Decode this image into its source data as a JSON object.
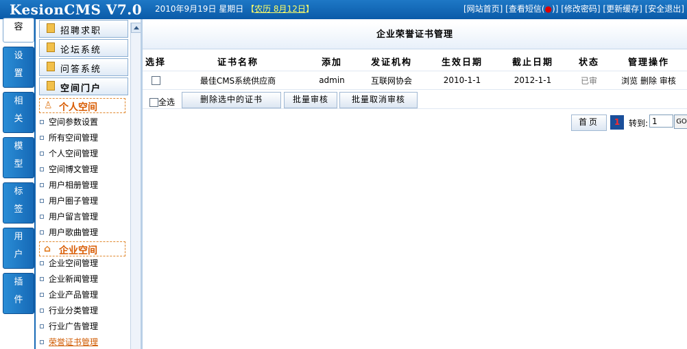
{
  "header": {
    "logo": "KesionCMS V7.0",
    "date": "2010年9月19日 星期日",
    "lunar_open": "【",
    "lunar": "农历 8月12日",
    "lunar_close": "】",
    "links": [
      "[网站首页]",
      "[查看短信(",
      ")]",
      "[修改密码]",
      "[更新缓存]",
      "[安全退出]"
    ],
    "msg_dot": "●"
  },
  "tabs": [
    {
      "c1": "容",
      "c2": ""
    },
    {
      "c1": "设",
      "c2": "置"
    },
    {
      "c1": "相",
      "c2": "关"
    },
    {
      "c1": "模",
      "c2": "型"
    },
    {
      "c1": "标",
      "c2": "签"
    },
    {
      "c1": "用",
      "c2": "户"
    },
    {
      "c1": "插",
      "c2": "件"
    }
  ],
  "menu": {
    "buttons": [
      "招聘求职",
      "论坛系统",
      "问答系统",
      "空间门户"
    ],
    "group1": {
      "title": "个人空间",
      "items": [
        "空间参数设置",
        "所有空间管理",
        "个人空间管理",
        "空间博文管理",
        "用户相册管理",
        "用户圈子管理",
        "用户留言管理",
        "用户歌曲管理"
      ]
    },
    "group2": {
      "title": "企业空间",
      "items": [
        "企业空间管理",
        "企业新闻管理",
        "企业产品管理",
        "行业分类管理",
        "行业广告管理",
        "荣誉证书管理"
      ]
    }
  },
  "main": {
    "title": "企业荣誉证书管理",
    "columns": [
      "选择",
      "证书名称",
      "添加",
      "发证机构",
      "生效日期",
      "截止日期",
      "状态",
      "管理操作"
    ],
    "rows": [
      {
        "name": "最佳CMS系统供应商",
        "adder": "admin",
        "org": "互联网协会",
        "start": "2010-1-1",
        "end": "2012-1-1",
        "status": "已审",
        "ops": [
          "浏览",
          "删除",
          "审核"
        ]
      }
    ],
    "select_all": "全选",
    "buttons": [
      "删除选中的证书",
      "批量审核",
      "批量取消审核"
    ],
    "pager": {
      "first": "首页",
      "current": "1",
      "goto": "转到:",
      "page_value": "1",
      "go": "GO"
    }
  }
}
